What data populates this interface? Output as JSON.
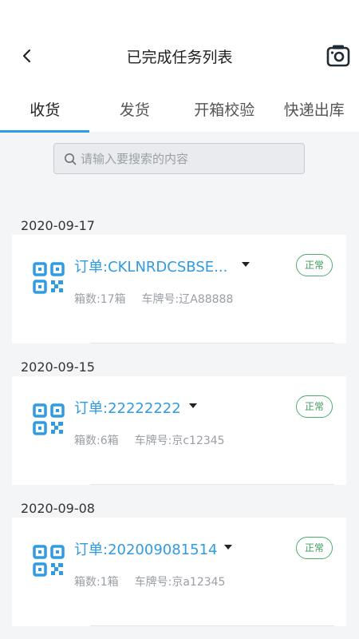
{
  "header": {
    "title": "已完成任务列表",
    "back_icon": "chevron-left-icon",
    "camera_icon": "camera-icon"
  },
  "tabs": [
    {
      "label": "收货",
      "active": true
    },
    {
      "label": "发货",
      "active": false
    },
    {
      "label": "开箱校验",
      "active": false
    },
    {
      "label": "快递出库",
      "active": false
    }
  ],
  "search": {
    "placeholder": "请输入要搜索的内容",
    "value": ""
  },
  "colors": {
    "accent": "#2f9be3",
    "status_green": "#3f9d5d"
  },
  "groups": [
    {
      "date": "2020-09-17",
      "order": {
        "number_label": "订单:CKLNRDCSBSE...",
        "boxes": "箱数:17箱",
        "plate": "车牌号:辽A88888",
        "status": "正常"
      }
    },
    {
      "date": "2020-09-15",
      "order": {
        "number_label": "订单:22222222",
        "boxes": "箱数:6箱",
        "plate": "车牌号:京c12345",
        "status": "正常"
      }
    },
    {
      "date": "2020-09-08",
      "order": {
        "number_label": "订单:202009081514",
        "boxes": "箱数:1箱",
        "plate": "车牌号:京a12345",
        "status": "正常"
      }
    }
  ]
}
